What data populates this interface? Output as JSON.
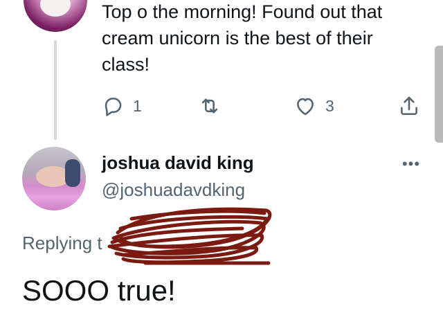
{
  "parent_tweet": {
    "text": "Top o the morning! Found out that cream unicorn is the best of their class!",
    "stats": {
      "replies": "1",
      "likes": "3"
    },
    "icons": {
      "reply": "reply-bubble-icon",
      "retweet": "retweet-icon",
      "like": "heart-icon",
      "share": "share-icon"
    }
  },
  "reply_tweet": {
    "author": {
      "display_name": "joshua david king",
      "handle": "@joshuadavdking"
    },
    "replying_prefix": "Replying t",
    "text": "SOOO true!",
    "more_icon": "more-dots-icon",
    "redaction_color": "#7a1a10"
  },
  "colors": {
    "text_primary": "#0f1419",
    "text_secondary": "#536471",
    "accent": "#1d9bf0",
    "thread_line": "#cfd9de"
  }
}
